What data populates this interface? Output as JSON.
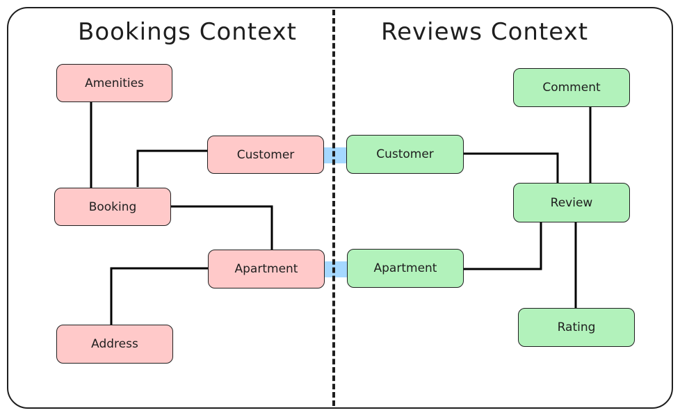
{
  "contexts": [
    {
      "title": "Bookings Context",
      "color": "#ffc9c9"
    },
    {
      "title": "Reviews Context",
      "color": "#b2f2bb"
    }
  ],
  "bookings": {
    "amenities": "Amenities",
    "customer": "Customer",
    "booking": "Booking",
    "apartment": "Apartment",
    "address": "Address"
  },
  "reviews": {
    "comment": "Comment",
    "customer": "Customer",
    "review": "Review",
    "apartment": "Apartment",
    "rating": "Rating"
  },
  "relations": [
    {
      "from": "Amenities",
      "to": "Booking",
      "context": "Bookings"
    },
    {
      "from": "Customer",
      "to": "Booking",
      "context": "Bookings"
    },
    {
      "from": "Booking",
      "to": "Apartment",
      "context": "Bookings"
    },
    {
      "from": "Apartment",
      "to": "Address",
      "context": "Bookings"
    },
    {
      "from": "Customer",
      "to": "Review",
      "context": "Reviews"
    },
    {
      "from": "Comment",
      "to": "Review",
      "context": "Reviews"
    },
    {
      "from": "Apartment",
      "to": "Review",
      "context": "Reviews"
    },
    {
      "from": "Review",
      "to": "Rating",
      "context": "Reviews"
    }
  ],
  "bridges": [
    {
      "from": "Bookings.Customer",
      "to": "Reviews.Customer",
      "color": "#a5d8ff"
    },
    {
      "from": "Bookings.Apartment",
      "to": "Reviews.Apartment",
      "color": "#a5d8ff"
    }
  ]
}
